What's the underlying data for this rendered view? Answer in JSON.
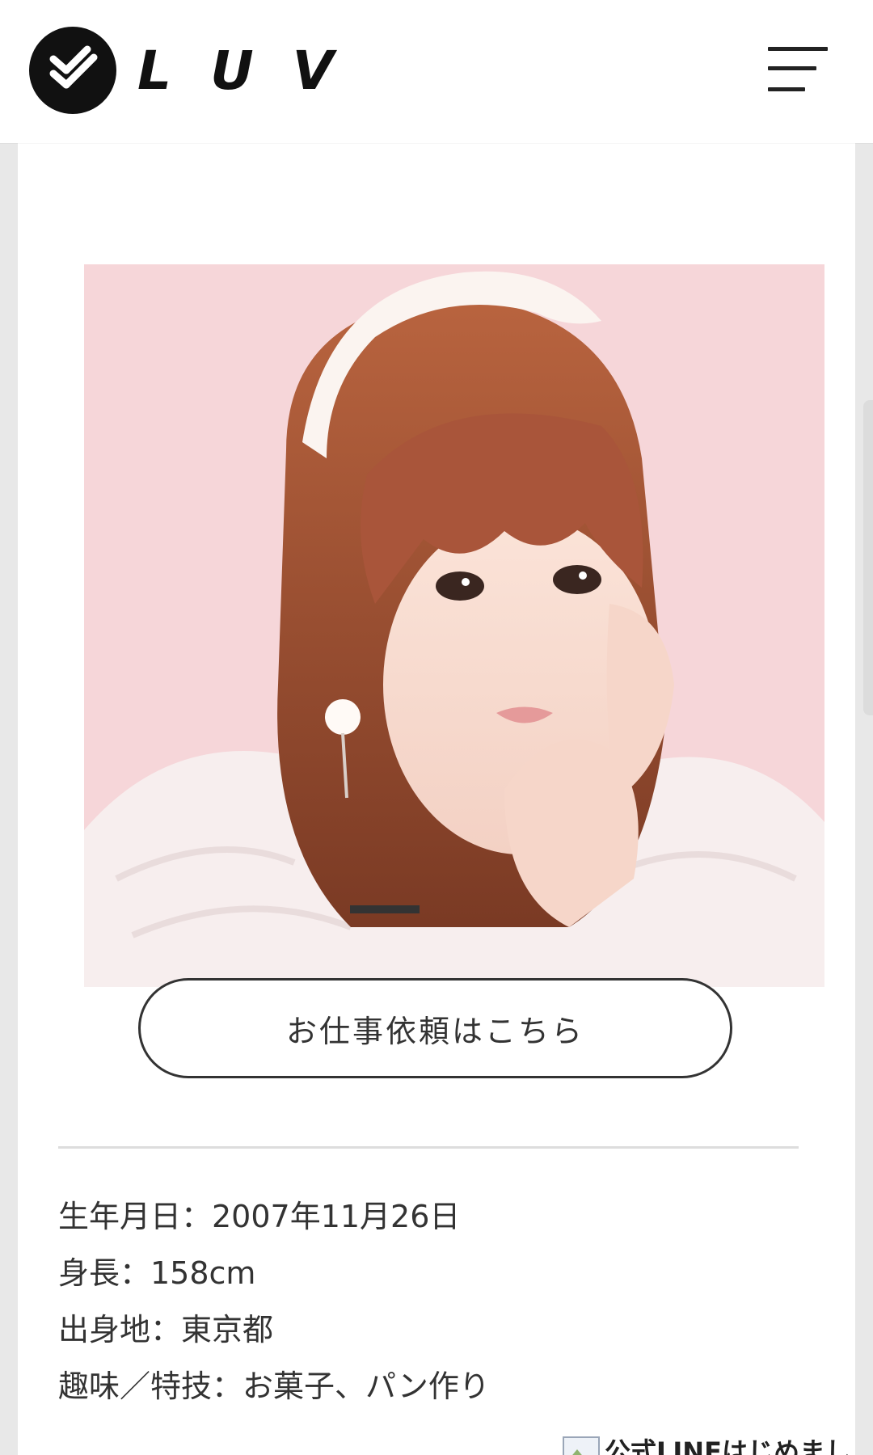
{
  "header": {
    "logo_letters": [
      "L",
      "U",
      "V"
    ],
    "logo_icon": "luv-check-icon",
    "menu_icon": "hamburger-menu-icon"
  },
  "photo": {
    "description_icon": "profile-photo"
  },
  "cta": {
    "label": "お仕事依頼はこちら"
  },
  "profile": {
    "rows": [
      "生年月日：2007年11月26日",
      "身長：158cm",
      "出身地：東京都",
      "趣味／特技：お菓子、パン作り"
    ]
  },
  "line_banner": {
    "label": "公式LINEはじめまし",
    "icon": "broken-image-icon"
  },
  "colors": {
    "header_bg": "#ffffff",
    "page_bg": "#e8e8e8",
    "text": "#333333",
    "photo_bg": "#f7d9dc"
  }
}
